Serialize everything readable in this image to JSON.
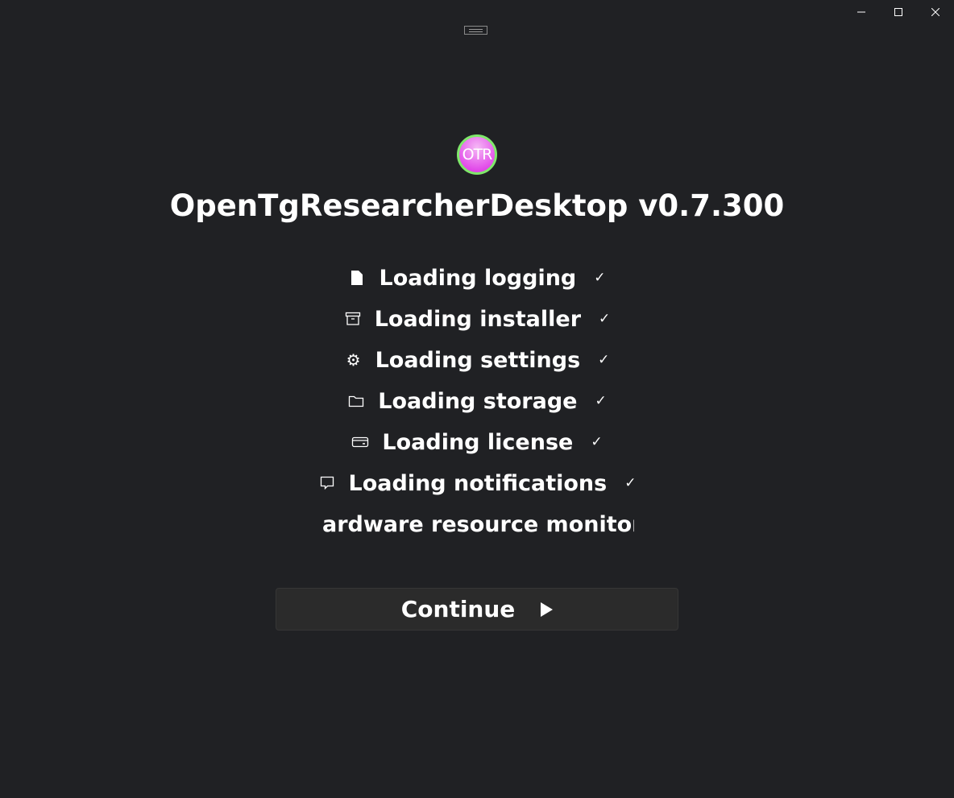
{
  "window": {
    "minimize_icon": "minimize-icon",
    "maximize_icon": "maximize-icon",
    "close_icon": "close-icon"
  },
  "logo_text": "OTR",
  "title": "OpenTgResearcherDesktop v0.7.300",
  "steps": [
    {
      "label": "Loading logging",
      "icon": "file-icon",
      "done": "✓"
    },
    {
      "label": "Loading installer",
      "icon": "archive-icon",
      "done": "✓"
    },
    {
      "label": "Loading settings",
      "icon": "gear-icon",
      "done": "✓"
    },
    {
      "label": "Loading storage",
      "icon": "folder-icon",
      "done": "✓"
    },
    {
      "label": "Loading license",
      "icon": "card-icon",
      "done": "✓"
    },
    {
      "label": "Loading notifications",
      "icon": "comment-icon",
      "done": "✓"
    }
  ],
  "current_step": "ardware resource monitoring",
  "continue_label": "Continue",
  "colors": {
    "background": "#202124",
    "button": "#2b2b2b",
    "logo_ring": "#7fe86a",
    "logo_fill": "#e040e8"
  }
}
